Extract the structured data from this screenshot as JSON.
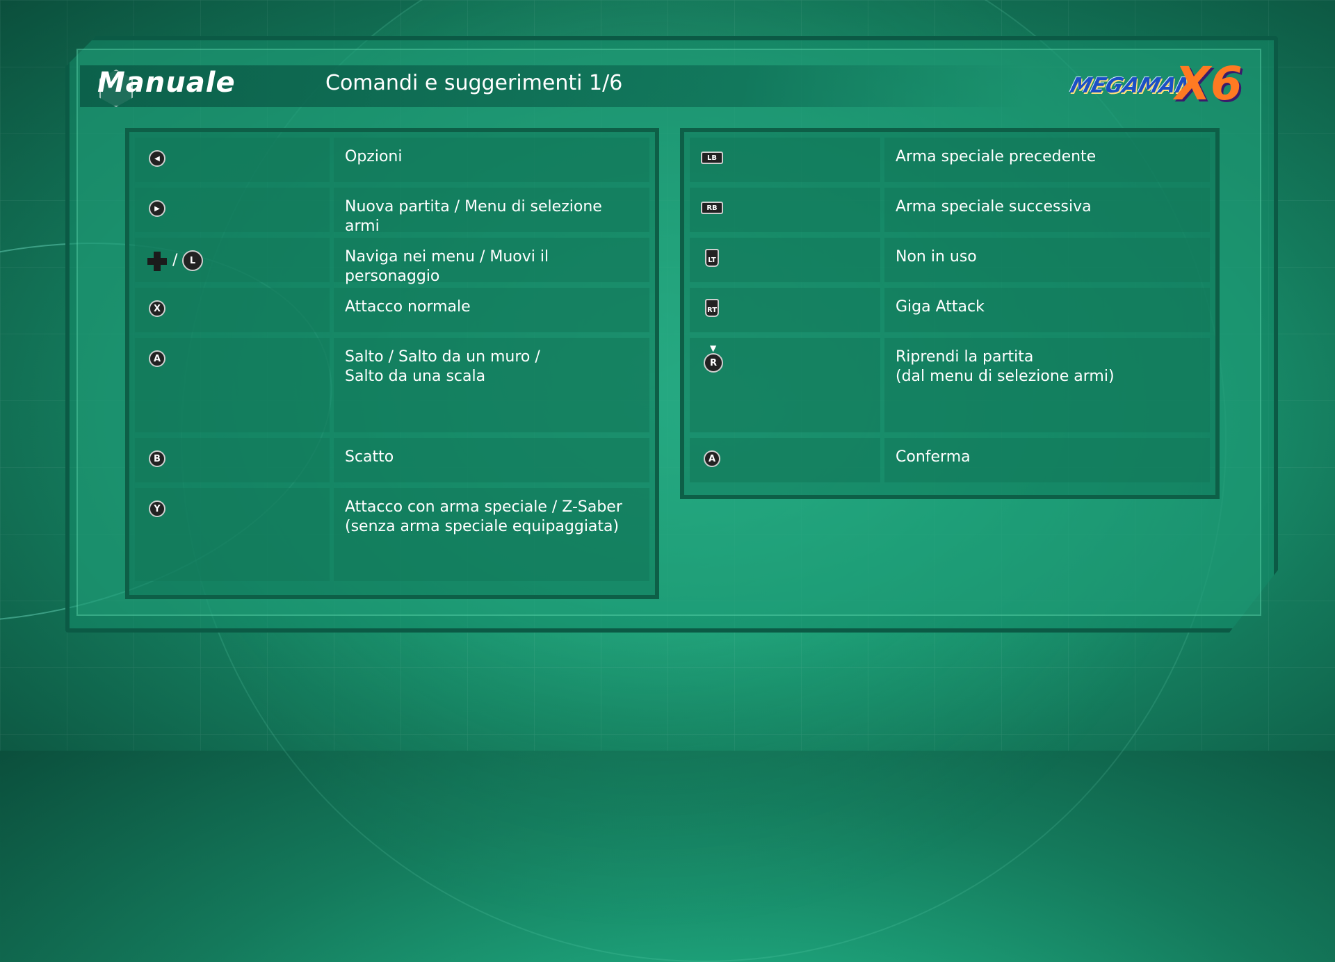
{
  "header": {
    "section_title": "Manuale",
    "page_title": "Comandi e suggerimenti 1/6"
  },
  "logo": {
    "megaman": "MEGAMAN",
    "x6": "X6"
  },
  "left_panel": {
    "rows": [
      {
        "icon": "back-button-icon",
        "glyph": "◀",
        "label": "Opzioni"
      },
      {
        "icon": "start-button-icon",
        "glyph": "▶",
        "label": "Nuova partita / Menu di selezione armi"
      },
      {
        "icon": "dpad-and-left-stick-icon",
        "glyph": "L",
        "label": "Naviga nei menu / Muovi il personaggio"
      },
      {
        "icon": "x-button-icon",
        "glyph": "X",
        "label": "Attacco normale"
      },
      {
        "icon": "a-button-icon",
        "glyph": "A",
        "label": "Salto / Salto da un muro /",
        "label2": "Salto da una scala"
      },
      {
        "icon": "b-button-icon",
        "glyph": "B",
        "label": "Scatto"
      },
      {
        "icon": "y-button-icon",
        "glyph": "Y",
        "label": "Attacco con arma speciale / Z-Saber",
        "label2": "(senza arma speciale equipaggiata)"
      }
    ]
  },
  "right_panel": {
    "rows": [
      {
        "icon": "lb-button-icon",
        "glyph": "LB",
        "label": "Arma speciale precedente"
      },
      {
        "icon": "rb-button-icon",
        "glyph": "RB",
        "label": "Arma speciale successiva"
      },
      {
        "icon": "lt-trigger-icon",
        "glyph": "LT",
        "label": "Non in uso"
      },
      {
        "icon": "rt-trigger-icon",
        "glyph": "RT",
        "label": "Giga Attack"
      },
      {
        "icon": "right-stick-press-icon",
        "glyph": "R",
        "label": "Riprendi la partita",
        "label2": "(dal menu di selezione armi)"
      },
      {
        "icon": "a-button-icon",
        "glyph": "A",
        "label": "Conferma"
      }
    ]
  },
  "colors": {
    "background": "#1ea57c",
    "panel_border": "#0d5f47",
    "text": "#ffffff",
    "logo_orange": "#ff7a22",
    "logo_blue": "#1b4fc4"
  }
}
